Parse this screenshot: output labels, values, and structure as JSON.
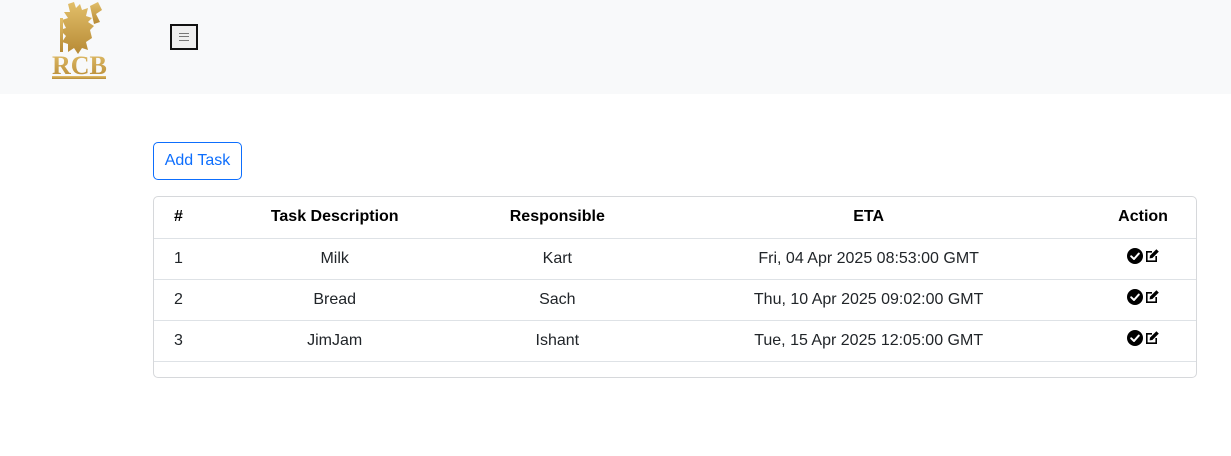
{
  "navbar": {
    "logo_icon": "rcb-lion-logo-icon",
    "toggler_icon": "hamburger-menu-icon"
  },
  "toolbar": {
    "add_task_label": "Add Task"
  },
  "colors": {
    "accent": "#0d6efd",
    "navbar_bg": "#f8f9fa",
    "logo_gold": "#c9a14a"
  },
  "table": {
    "headers": {
      "num": "#",
      "description": "Task Description",
      "responsible": "Responsible",
      "eta": "ETA",
      "action": "Action"
    },
    "rows": [
      {
        "num": "1",
        "description": "Milk",
        "responsible": "Kart",
        "eta": "Fri, 04 Apr 2025 08:53:00 GMT"
      },
      {
        "num": "2",
        "description": "Bread",
        "responsible": "Sach",
        "eta": "Thu, 10 Apr 2025 09:02:00 GMT"
      },
      {
        "num": "3",
        "description": "JimJam",
        "responsible": "Ishant",
        "eta": "Tue, 15 Apr 2025 12:05:00 GMT"
      }
    ],
    "action_icons": [
      "check-circle-icon",
      "edit-icon"
    ]
  }
}
